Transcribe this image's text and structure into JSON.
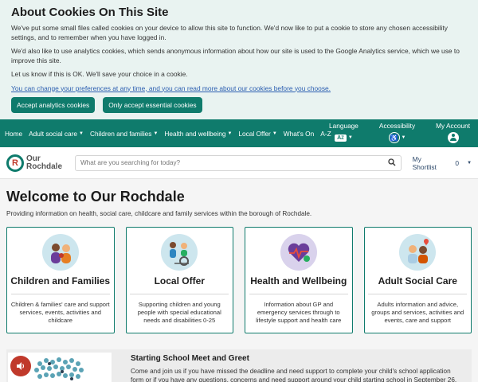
{
  "cookie": {
    "title": "About Cookies On This Site",
    "p1": "We've put some small files called cookies on your device to allow this site to function. We'd now like to put a cookie to store any chosen accessibility settings, and to remember when you have logged in.",
    "p2": "We'd also like to use analytics cookies, which sends anonymous information about how our site is used to the Google Analytics service, which we use to improve this site.",
    "p3": "Let us know if this is OK. We'll save your choice in a cookie.",
    "link": "You can change your preferences at any time, and you can read more about our cookies before you choose.",
    "accept_analytics": "Accept analytics cookies",
    "accept_essential": "Only accept essential cookies"
  },
  "nav": {
    "home": "Home",
    "adult": "Adult social care",
    "children": "Children and families",
    "health": "Health and wellbeing",
    "local": "Local Offer",
    "whats_on": "What's On",
    "az": "A-Z",
    "language": "Language",
    "language_icon": "A-Z-icon",
    "accessibility": "Accessibility",
    "account": "My Account"
  },
  "header": {
    "logo_line1": "Our",
    "logo_line2": "Rochdale",
    "search_placeholder": "What are you searching for today?",
    "shortlist_label": "My Shortlist",
    "shortlist_count": "0"
  },
  "main": {
    "title": "Welcome to Our Rochdale",
    "intro": "Providing information on health, social care, childcare and family services within the borough of Rochdale.",
    "cards": [
      {
        "title": "Children and Families",
        "desc": "Children & families' care and support services, events, activities and childcare"
      },
      {
        "title": "Local Offer",
        "desc": "Supporting children and young people with special educational needs and disabilities 0-25"
      },
      {
        "title": "Health and Wellbeing",
        "desc": "Information about GP and emergency services through to lifestyle support and health care"
      },
      {
        "title": "Adult Social Care",
        "desc": "Adults information and advice, groups and services, activities and events, care and support"
      }
    ]
  },
  "feature": {
    "title": "Starting School Meet and Greet",
    "text": "Come and join us if you have missed the deadline and need support to complete your child's school application form or if you have any questions, concerns and need support around your child starting school in September 26."
  },
  "colors": {
    "brand": "#0f7b6c",
    "accent_red": "#c0392b"
  }
}
